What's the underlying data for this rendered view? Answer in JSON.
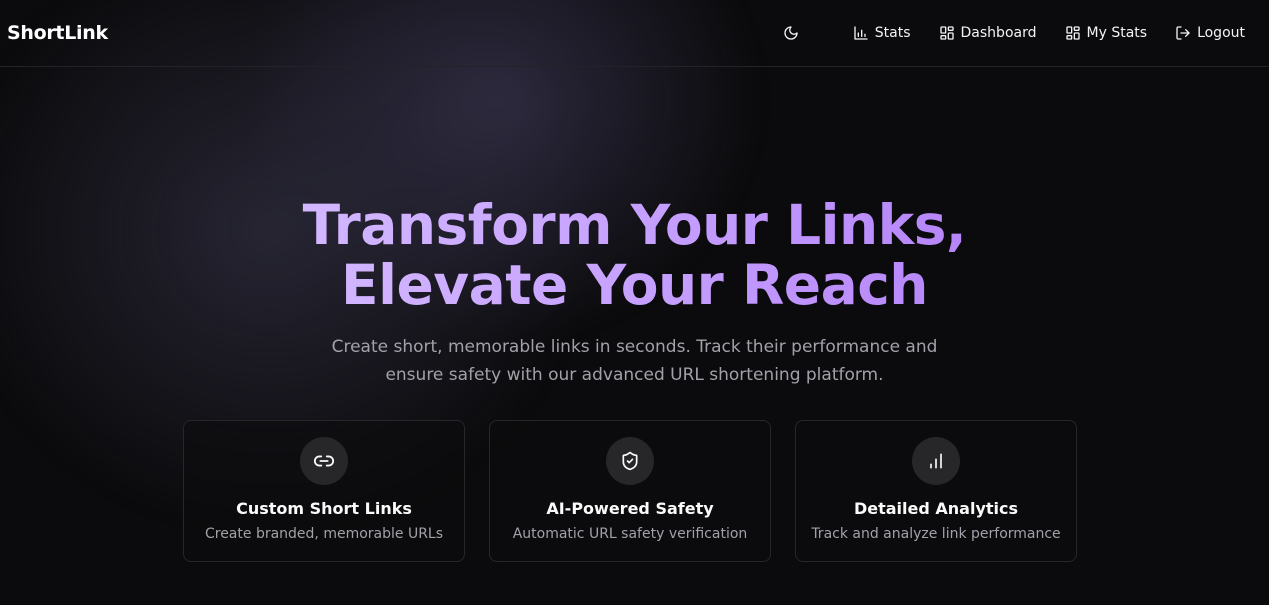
{
  "app": {
    "logo": "ShortLink"
  },
  "nav": {
    "theme_icon": "moon-icon",
    "items": [
      {
        "label": "Stats",
        "icon": "bar-chart-icon"
      },
      {
        "label": "Dashboard",
        "icon": "grid-icon"
      },
      {
        "label": "My Stats",
        "icon": "grid-icon"
      },
      {
        "label": "Logout",
        "icon": "logout-icon"
      }
    ]
  },
  "hero": {
    "headline_line1": "Transform Your Links,",
    "headline_line2": "Elevate Your Reach",
    "subtitle": "Create short, memorable links in seconds. Track their performance and ensure safety with our advanced URL shortening platform."
  },
  "features": [
    {
      "icon": "link-icon",
      "title": "Custom Short Links",
      "description": "Create branded, memorable URLs"
    },
    {
      "icon": "shield-check-icon",
      "title": "AI-Powered Safety",
      "description": "Automatic URL safety verification"
    },
    {
      "icon": "bar-chart-icon",
      "title": "Detailed Analytics",
      "description": "Track and analyze link performance"
    }
  ],
  "colors": {
    "background": "#0b0b0d",
    "accent_start": "#ddcbff",
    "accent_end": "#a86cf4",
    "muted_text": "#a1a1aa",
    "card_border": "#27272a"
  }
}
